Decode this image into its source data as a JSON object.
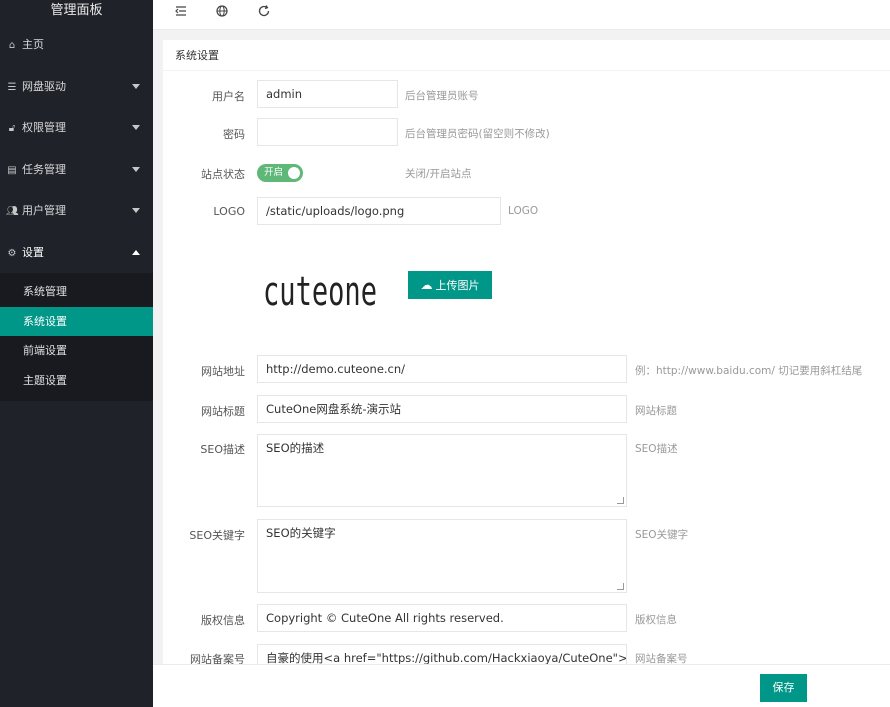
{
  "sidebar": {
    "brand": "管理面板",
    "items": [
      {
        "label": "主页",
        "icon": "home-icon"
      },
      {
        "label": "网盘驱动",
        "icon": "list-icon"
      },
      {
        "label": "权限管理",
        "icon": "lock-icon"
      },
      {
        "label": "任务管理",
        "icon": "task-icon"
      },
      {
        "label": "用户管理",
        "icon": "users-icon"
      },
      {
        "label": "设置",
        "icon": "gear-icon"
      }
    ],
    "sub_items": [
      {
        "label": "系统管理"
      },
      {
        "label": "系统设置"
      },
      {
        "label": "前端设置"
      },
      {
        "label": "主题设置"
      }
    ]
  },
  "topbar": {
    "icons": [
      "menu-collapse-icon",
      "globe-icon",
      "refresh-icon"
    ]
  },
  "panel": {
    "title": "系统设置"
  },
  "form": {
    "username": {
      "label": "用户名",
      "value": "admin",
      "hint": "后台管理员账号"
    },
    "password": {
      "label": "密码",
      "value": "",
      "hint": "后台管理员密码(留空则不修改)"
    },
    "site_status": {
      "label": "站点状态",
      "switch_text": "开启",
      "on": true,
      "hint": "关闭/开启站点"
    },
    "logo": {
      "label": "LOGO",
      "value": "/static/uploads/logo.png",
      "hint": "LOGO",
      "logo_text": "cuteone",
      "upload_label": "上传图片"
    },
    "site_url": {
      "label": "网站地址",
      "value": "http://demo.cuteone.cn/",
      "hint": "例：http://www.baidu.com/ 切记要用斜杠结尾"
    },
    "site_title": {
      "label": "网站标题",
      "value": "CuteOne网盘系统-演示站",
      "hint": "网站标题"
    },
    "seo_desc": {
      "label": "SEO描述",
      "value": "SEO的描述",
      "hint": "SEO描述"
    },
    "seo_keywords": {
      "label": "SEO关键字",
      "value": "SEO的关键字",
      "hint": "SEO关键字"
    },
    "copyright": {
      "label": "版权信息",
      "value": "Copyright © CuteOne All rights reserved.",
      "hint": "版权信息"
    },
    "icp": {
      "label": "网站备案号",
      "value": "自豪的使用<a href=\"https://github.com/Hackxiaoya/CuteOne\">CuteOne</a>",
      "hint": "网站备案号"
    }
  },
  "footer": {
    "save_label": "保存"
  },
  "colors": {
    "sidebar_bg": "#20222a",
    "accent": "#009688",
    "switch_on": "#5fb878"
  }
}
